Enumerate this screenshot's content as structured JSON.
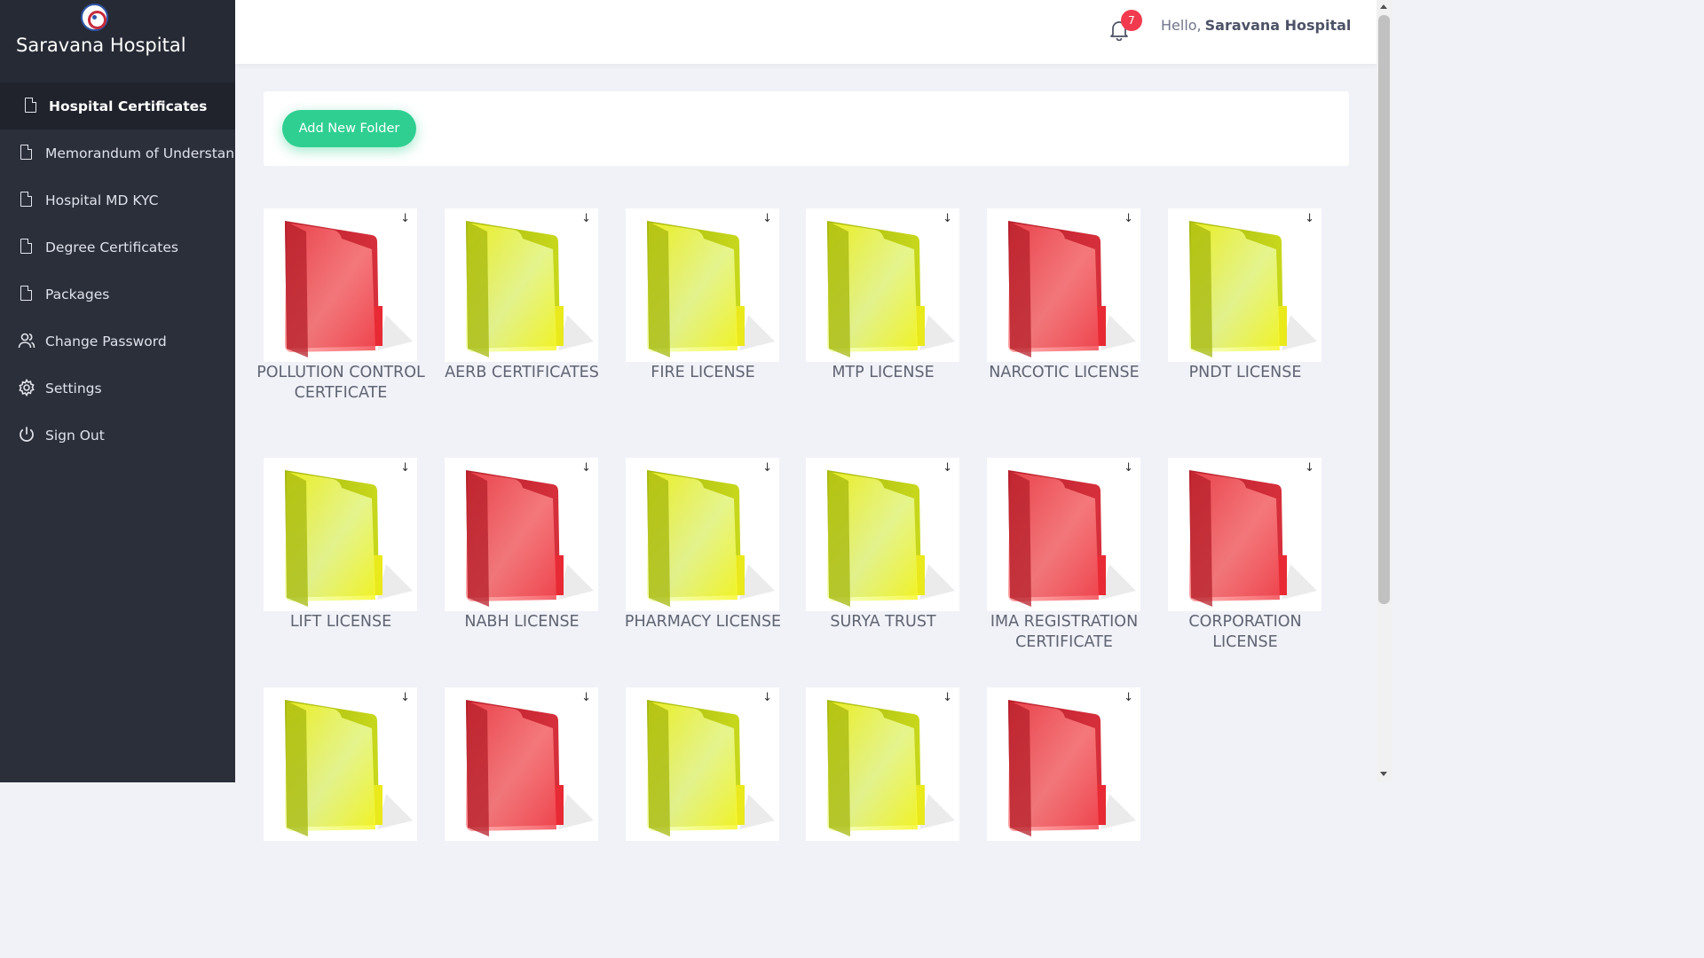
{
  "brand": {
    "name": "Saravana Hospital",
    "logo_icon": "hospital-logo-icon"
  },
  "sidebar": {
    "items": [
      {
        "label": "Hospital Certificates",
        "icon": "document-icon",
        "active": true
      },
      {
        "label": "Memorandum of Understanding",
        "icon": "document-icon",
        "active": false
      },
      {
        "label": "Hospital MD KYC",
        "icon": "document-icon",
        "active": false
      },
      {
        "label": "Degree Certificates",
        "icon": "document-icon",
        "active": false
      },
      {
        "label": "Packages",
        "icon": "document-icon",
        "active": false
      },
      {
        "label": "Change Password",
        "icon": "users-icon",
        "active": false
      },
      {
        "label": "Settings",
        "icon": "gear-icon",
        "active": false
      },
      {
        "label": "Sign Out",
        "icon": "power-icon",
        "active": false
      }
    ]
  },
  "header": {
    "notification_count": "7",
    "greeting": "Hello,",
    "user_name": "Saravana Hospital"
  },
  "toolbar": {
    "add_folder_label": "Add New Folder"
  },
  "download_glyph": "↓",
  "colors": {
    "red_folder": "#e8333d",
    "yellow_folder": "#f2f21e",
    "accent": "#2fcf91",
    "badge": "#f23a4e"
  },
  "folders": [
    {
      "name": "POLLUTION CONTROL CERTFICATE",
      "color": "red"
    },
    {
      "name": "AERB CERTIFICATES",
      "color": "yellow"
    },
    {
      "name": "FIRE LICENSE",
      "color": "yellow"
    },
    {
      "name": "MTP LICENSE",
      "color": "yellow"
    },
    {
      "name": "NARCOTIC LICENSE",
      "color": "red"
    },
    {
      "name": "PNDT LICENSE",
      "color": "yellow"
    },
    {
      "name": "LIFT LICENSE",
      "color": "yellow"
    },
    {
      "name": "NABH LICENSE",
      "color": "red"
    },
    {
      "name": "PHARMACY LICENSE",
      "color": "yellow"
    },
    {
      "name": "SURYA TRUST",
      "color": "yellow"
    },
    {
      "name": "IMA REGISTRATION CERTIFICATE",
      "color": "red"
    },
    {
      "name": "CORPORATION LICENSE",
      "color": "red"
    },
    {
      "name": "",
      "color": "yellow"
    },
    {
      "name": "",
      "color": "red"
    },
    {
      "name": "",
      "color": "yellow"
    },
    {
      "name": "",
      "color": "yellow"
    },
    {
      "name": "",
      "color": "red"
    }
  ]
}
